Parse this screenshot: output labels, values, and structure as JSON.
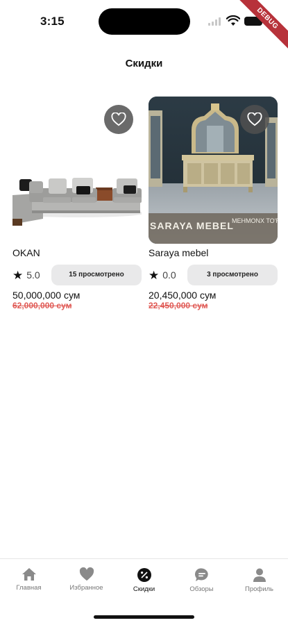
{
  "status_bar": {
    "time": "3:15"
  },
  "debug_banner": "DEBUG",
  "header": {
    "title": "Скидки"
  },
  "products": [
    {
      "name": "OKAN",
      "rating": "5.0",
      "views": "15 просмотрено",
      "price": "50,000,000 сум",
      "old_price": "62,000,000 сум",
      "image_icon": "sofa-photo",
      "favorite_icon": "heart-outline-icon"
    },
    {
      "name": "Saraya mebel",
      "rating": "0.0",
      "views": "3 просмотрено",
      "price": "20,450,000 сум",
      "old_price": "22,450,000 сум",
      "image_icon": "sideboard-photo",
      "image_text_left": "SARAYA MEBEL",
      "image_text_right": "MEHMONX TO'R",
      "favorite_icon": "heart-outline-icon"
    }
  ],
  "nav": {
    "items": [
      {
        "label": "Главная",
        "icon": "home-icon"
      },
      {
        "label": "Избранное",
        "icon": "heart-icon"
      },
      {
        "label": "Скидки",
        "icon": "discount-icon"
      },
      {
        "label": "Обзоры",
        "icon": "chat-icon"
      },
      {
        "label": "Профиль",
        "icon": "person-icon"
      }
    ],
    "active": "Скидки"
  },
  "colors": {
    "accent": "#111111",
    "discount_red": "#e05a55",
    "pill_bg": "#e9e9ea"
  }
}
